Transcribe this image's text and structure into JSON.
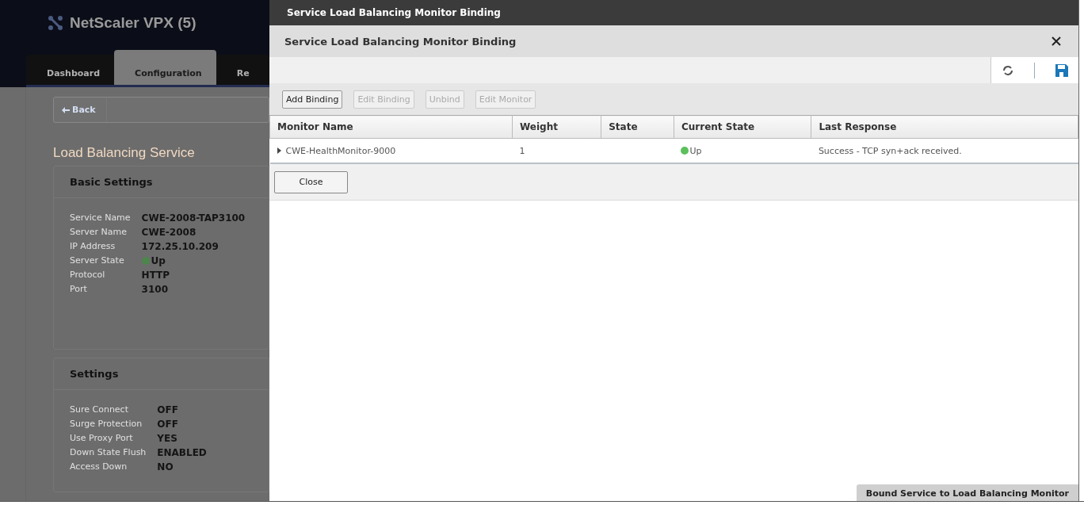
{
  "background": {
    "app_title": "NetScaler VPX (5)",
    "tabs": [
      {
        "label": "Dashboard",
        "selected": false
      },
      {
        "label": "Configuration",
        "selected": true
      },
      {
        "label": "Re",
        "selected": false
      }
    ],
    "back_button": "Back",
    "page_title": "Load Balancing Service",
    "sections": [
      {
        "title": "Basic Settings",
        "fields": [
          {
            "label": "Service Name",
            "value": "CWE-2008-TAP3100",
            "kind": "text"
          },
          {
            "label": "Server Name",
            "value": "CWE-2008",
            "kind": "text"
          },
          {
            "label": "IP Address",
            "value": "172.25.10.209",
            "kind": "text"
          },
          {
            "label": "Server State",
            "value": "Up",
            "kind": "status"
          },
          {
            "label": "Protocol",
            "value": "HTTP",
            "kind": "text"
          },
          {
            "label": "Port",
            "value": "3100",
            "kind": "text"
          }
        ]
      },
      {
        "title": "Settings",
        "fields": [
          {
            "label": "Sure Connect",
            "value": "OFF",
            "kind": "text"
          },
          {
            "label": "Surge Protection",
            "value": "OFF",
            "kind": "text"
          },
          {
            "label": "Use Proxy Port",
            "value": "YES",
            "kind": "text"
          },
          {
            "label": "Down State Flush",
            "value": "ENABLED",
            "kind": "text"
          },
          {
            "label": "Access Down",
            "value": "NO",
            "kind": "text"
          }
        ]
      }
    ]
  },
  "dialog": {
    "window_title": "Service Load Balancing Monitor Binding",
    "title": "Service Load Balancing Monitor Binding",
    "buttons": [
      {
        "label": "Add Binding",
        "disabled": false
      },
      {
        "label": "Edit Binding",
        "disabled": true
      },
      {
        "label": "Unbind",
        "disabled": true
      },
      {
        "label": "Edit Monitor",
        "disabled": true
      }
    ],
    "table": {
      "columns": [
        "Monitor Name",
        "Weight",
        "State",
        "Current State",
        "Last Response"
      ],
      "rows": [
        {
          "expanded": false,
          "monitor_name": "CWE-HealthMonitor-9000",
          "weight": "1",
          "current_state": "Up",
          "last_response": "Success - TCP syn+ack received."
        }
      ]
    },
    "close_button": "Close",
    "status_tab": "Bound Service to Load Balancing Monitor"
  }
}
